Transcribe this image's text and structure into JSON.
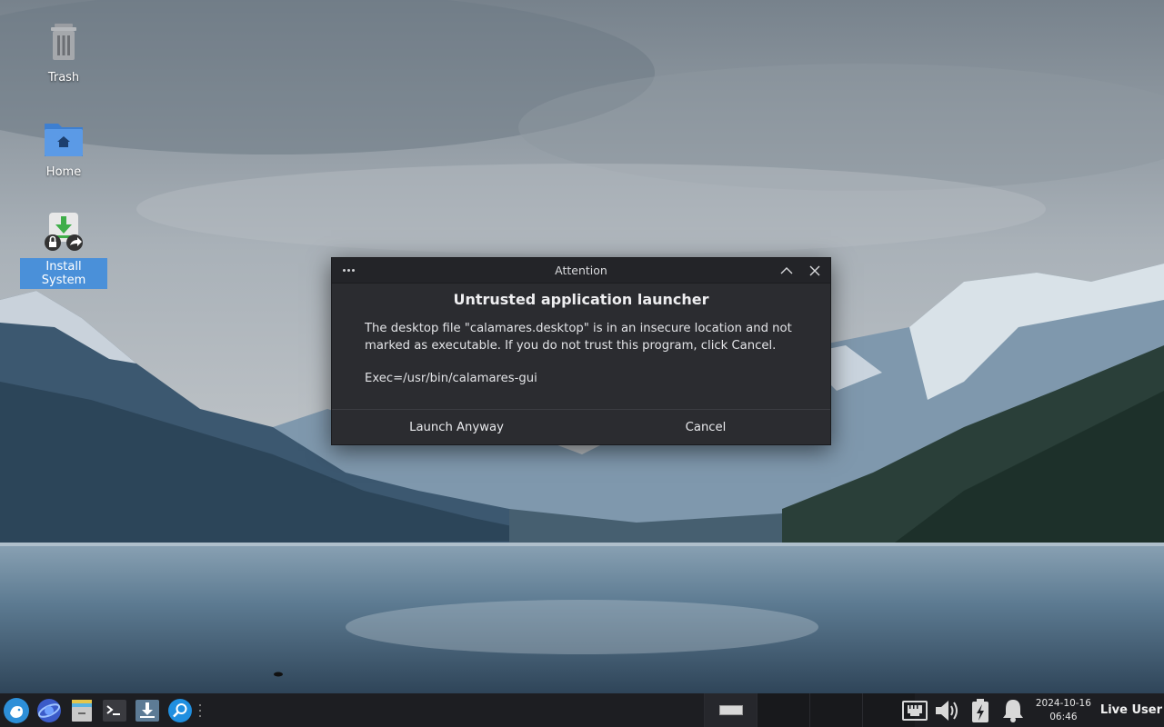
{
  "desktop": {
    "icons": [
      {
        "label": "Trash",
        "icon": "trash-icon"
      },
      {
        "label": "Home",
        "icon": "home-folder-icon"
      },
      {
        "label": "Install System",
        "icon": "install-system-icon",
        "selected": true
      }
    ]
  },
  "dialog": {
    "title": "Attention",
    "heading": "Untrusted application launcher",
    "message": "The desktop file \"calamares.desktop\" is in an insecure location and not marked as executable. If you do not trust this program, click Cancel.",
    "exec": "Exec=/usr/bin/calamares-gui",
    "buttons": {
      "launch": "Launch Anyway",
      "cancel": "Cancel"
    }
  },
  "taskbar": {
    "launchers": [
      "whisker-menu-icon",
      "web-browser-icon",
      "file-manager-icon",
      "terminal-icon",
      "downloads-icon",
      "app-finder-icon"
    ],
    "workspaces": 4,
    "tray": [
      "network-icon",
      "volume-icon",
      "power-icon",
      "notifications-icon"
    ],
    "clock": {
      "date": "2024-10-16",
      "time": "06:46"
    },
    "user": "Live User"
  },
  "colors": {
    "selection": "#4a90d9",
    "dialog_bg": "#2b2c30",
    "panel_bg": "#1d1e22"
  }
}
